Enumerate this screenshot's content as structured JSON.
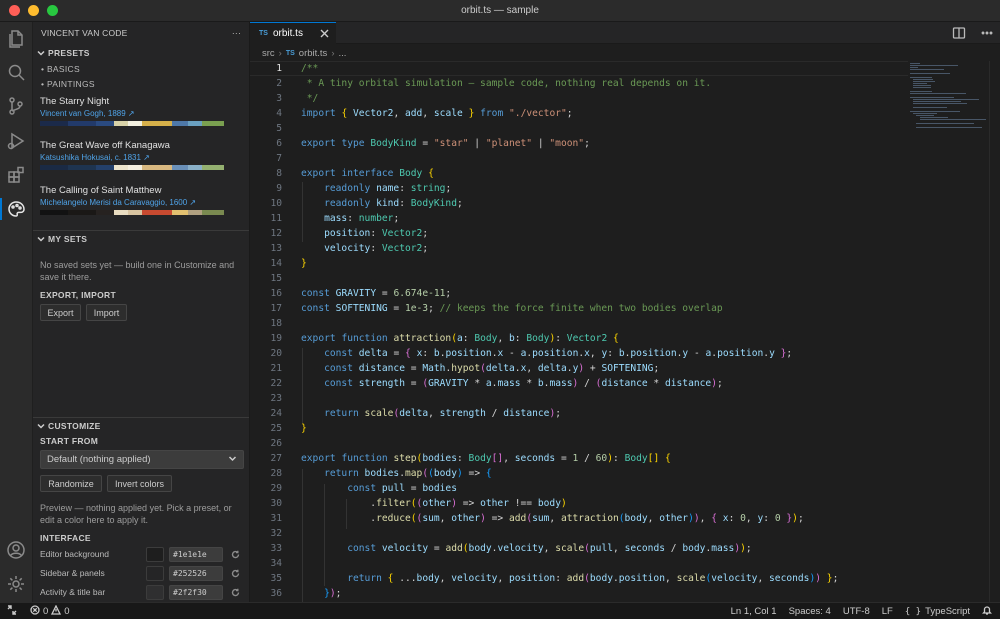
{
  "window": {
    "title": "orbit.ts — sample"
  },
  "sidebar": {
    "header": "VINCENT VAN CODE",
    "more": "···",
    "presets": {
      "title": "PRESETS",
      "groups": [
        "BASICS",
        "PAINTINGS"
      ],
      "paintings": [
        {
          "title": "The Starry Night",
          "artist": "Vincent van Gogh, 1889 ↗",
          "colors": [
            "#1b2a4a",
            "#1b2a4a",
            "#223a6a",
            "#223a6a",
            "#2a4a80",
            "#d8d2a8",
            "#f2f0e0",
            "#d6b04a",
            "#d6b04a",
            "#4e78a8",
            "#6aa0c0",
            "#7aa050"
          ]
        },
        {
          "title": "The Great Wave off Kanagawa",
          "artist": "Katsushika Hokusai, c. 1831 ↗",
          "colors": [
            "#1a2a44",
            "#1a2a44",
            "#1e3450",
            "#1e3450",
            "#24406a",
            "#ece4cc",
            "#f4efe0",
            "#d8b880",
            "#d8b880",
            "#6a90b8",
            "#8ab0c8",
            "#94b070"
          ]
        },
        {
          "title": "The Calling of Saint Matthew",
          "artist": "Michelangelo Merisi da Caravaggio, 1600 ↗",
          "colors": [
            "#121212",
            "#121212",
            "#1a1816",
            "#1a1816",
            "#262220",
            "#e8dcc0",
            "#d8c4a0",
            "#c84a30",
            "#c84a30",
            "#e2c070",
            "#b0a080",
            "#7a8a50"
          ]
        }
      ]
    },
    "my_sets": {
      "title": "MY SETS",
      "empty": "No saved sets yet — build one in Customize and save it there.",
      "export_import_label": "EXPORT, IMPORT",
      "export_label": "Export",
      "import_label": "Import"
    },
    "customize": {
      "title": "CUSTOMIZE",
      "start_from_label": "START FROM",
      "start_from_value": "Default (nothing applied)",
      "randomize_label": "Randomize",
      "invert_label": "Invert colors",
      "preview_text": "Preview — nothing applied yet. Pick a preset, or edit a color here to apply it.",
      "interface_label": "INTERFACE",
      "colors": [
        {
          "name": "Editor background",
          "hex": "#1e1e1e"
        },
        {
          "name": "Sidebar & panels",
          "hex": "#252526"
        },
        {
          "name": "Activity & title bar",
          "hex": "#2f2f30"
        }
      ]
    }
  },
  "editor": {
    "tab": {
      "badge": "TS",
      "name": "orbit.ts"
    },
    "breadcrumb": {
      "folder": "src",
      "badge": "TS",
      "file": "orbit.ts",
      "more": "..."
    },
    "current_line": 1
  },
  "statusbar": {
    "errors": "0",
    "warnings": "0",
    "position": "Ln 1, Col 1",
    "spaces": "Spaces: 4",
    "encoding": "UTF-8",
    "eol": "LF",
    "language": "TypeScript"
  }
}
